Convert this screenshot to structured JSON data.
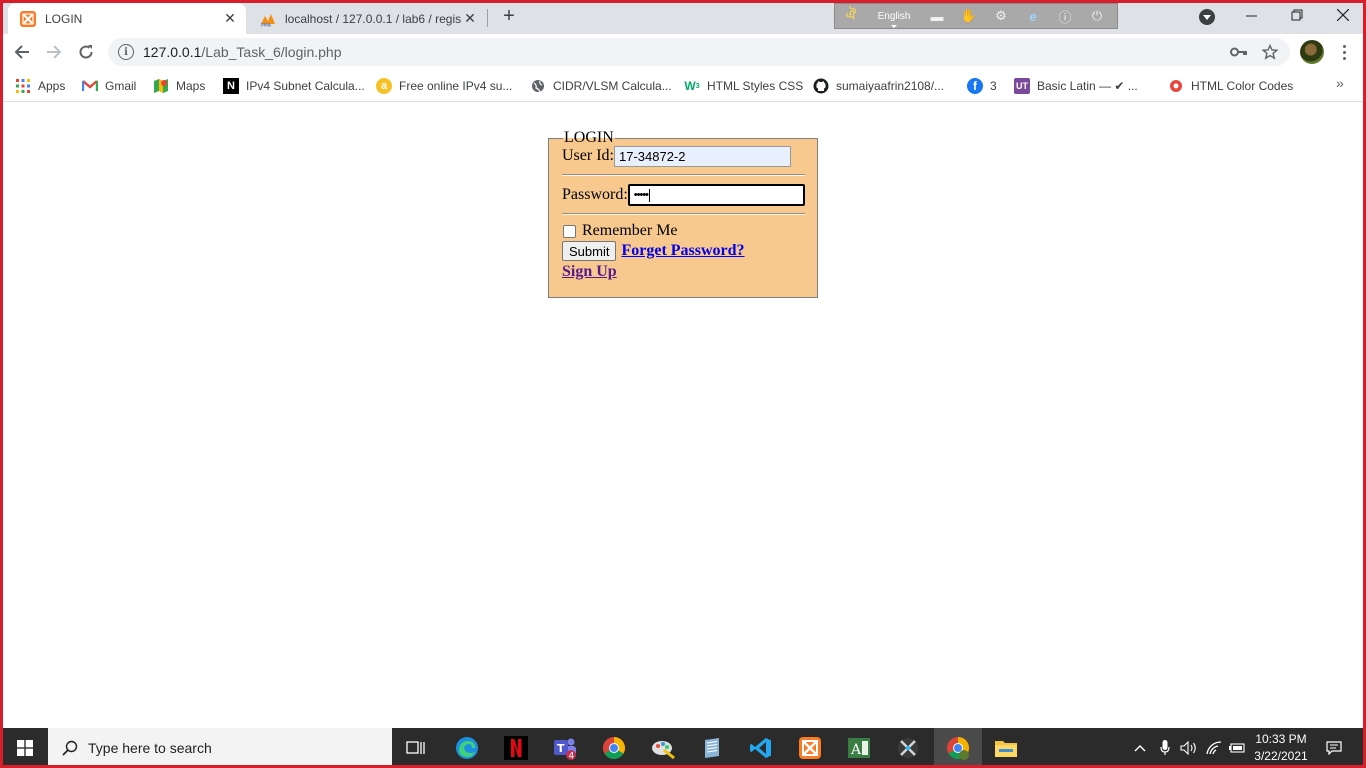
{
  "browser": {
    "tabs": [
      {
        "title": "LOGIN",
        "active": true
      },
      {
        "title": "localhost / 127.0.0.1 / lab6 / regis",
        "active": false
      }
    ],
    "new_tab_label": "+",
    "language_bar": {
      "language": "English"
    },
    "url": {
      "host": "127.0.0.1",
      "path": "/Lab_Task_6/login.php"
    },
    "bookmarks": [
      {
        "label": "Apps"
      },
      {
        "label": "Gmail"
      },
      {
        "label": "Maps"
      },
      {
        "label": "IPv4 Subnet Calcula..."
      },
      {
        "label": "Free online IPv4 su..."
      },
      {
        "label": "CIDR/VLSM Calcula..."
      },
      {
        "label": "HTML Styles CSS"
      },
      {
        "label": "sumaiyaafrin2108/..."
      },
      {
        "label": "3"
      },
      {
        "label": "Basic Latin — ✔ ..."
      },
      {
        "label": "HTML Color Codes"
      }
    ],
    "bookmarks_more": "»"
  },
  "login": {
    "legend": "LOGIN",
    "user_id_label": "User Id:",
    "user_id_value": "17-34872-2",
    "password_label": "Password:",
    "password_mask": "•••••",
    "remember_label": "Remember Me",
    "remember_checked": false,
    "submit_label": "Submit",
    "forgot_link": "Forget Password?",
    "signup_link": "Sign Up"
  },
  "taskbar": {
    "search_placeholder": "Type here to search",
    "teams_badge": "4",
    "time": "10:33 PM",
    "date": "3/22/2021"
  },
  "colors": {
    "frame": "#d81e2a",
    "login_bg": "#f7c98f",
    "link": "#0000ee",
    "visited_link": "#551a8b",
    "taskbar": "#2b2b2b"
  }
}
